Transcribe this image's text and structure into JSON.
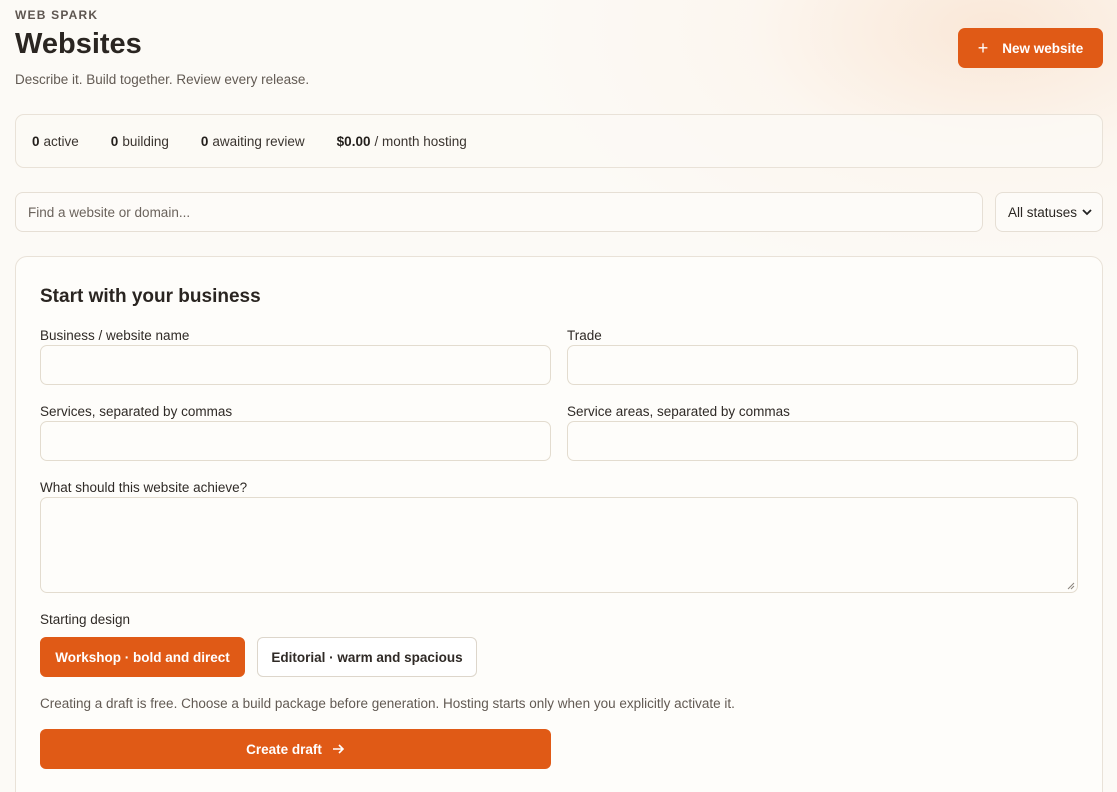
{
  "header": {
    "eyebrow": "WEB SPARK",
    "title": "Websites",
    "subtitle": "Describe it. Build together. Review every release.",
    "new_button_label": "New website",
    "new_button_icon": "plus-icon"
  },
  "stats": {
    "active_count": "0",
    "active_label": "active",
    "building_count": "0",
    "building_label": "building",
    "review_count": "0",
    "review_label": "awaiting review",
    "hosting_amount": "$0.00",
    "hosting_label": "/ month hosting"
  },
  "filters": {
    "search_placeholder": "Find a website or domain...",
    "status_selected": "All statuses"
  },
  "form": {
    "heading": "Start with your business",
    "name_label": "Business / website name",
    "trade_label": "Trade",
    "services_label": "Services, separated by commas",
    "areas_label": "Service areas, separated by commas",
    "goal_label": "What should this website achieve?",
    "design_label": "Starting design",
    "design_options": [
      {
        "label": "Workshop · bold and direct",
        "selected": true
      },
      {
        "label": "Editorial · warm and spacious",
        "selected": false
      }
    ],
    "note": "Creating a draft is free. Choose a build package before generation. Hosting starts only when you explicitly activate it.",
    "create_label": "Create draft",
    "create_icon": "arrow-right-icon"
  },
  "colors": {
    "accent": "#e05a16",
    "background": "#fcfaf6",
    "border": "#e9e2d8"
  }
}
